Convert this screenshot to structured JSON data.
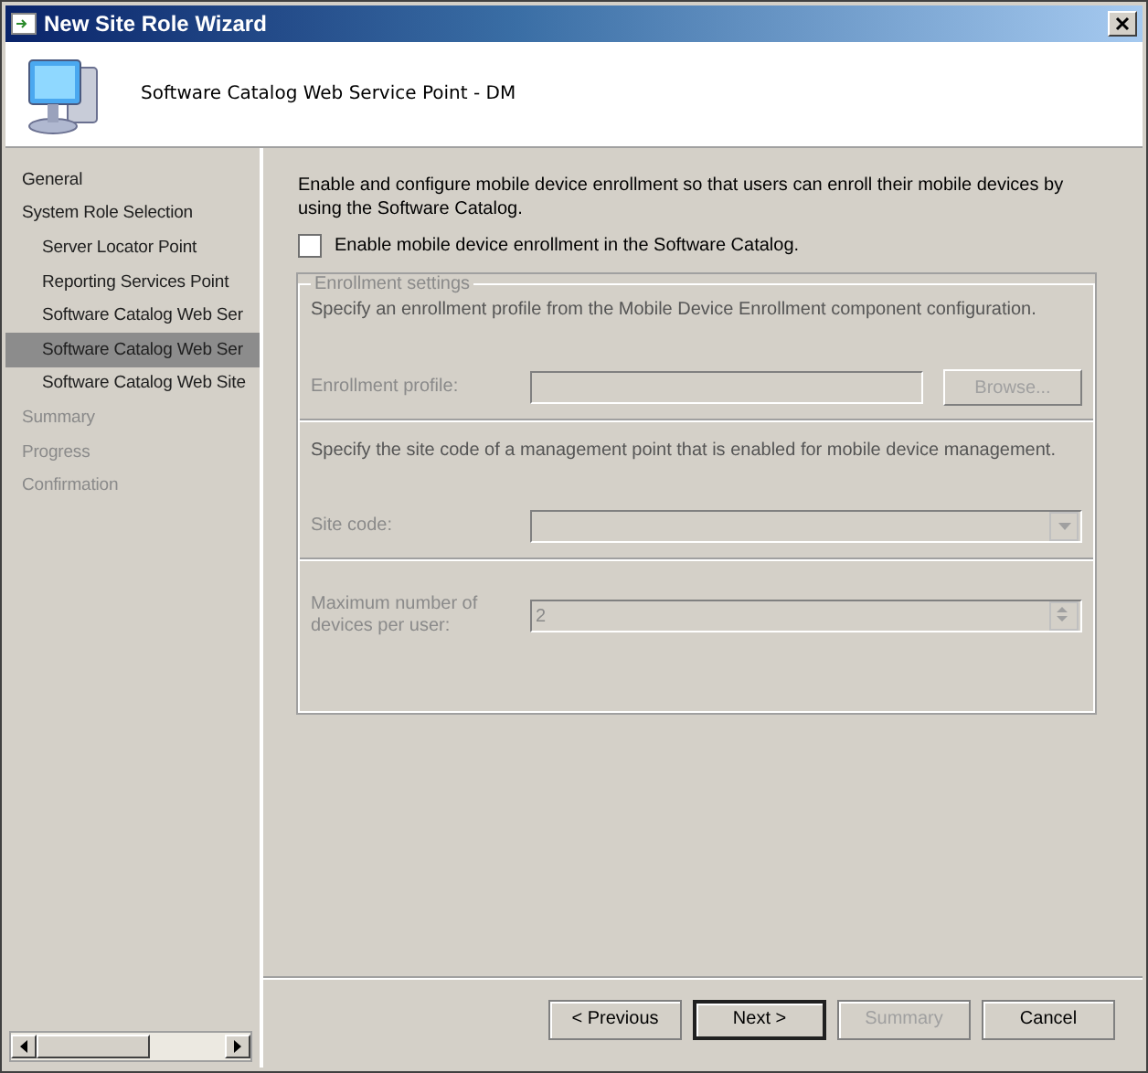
{
  "window": {
    "title": "New Site Role Wizard"
  },
  "header": {
    "title": "Software Catalog Web Service Point - DM"
  },
  "sidebar": {
    "items": [
      {
        "label": "General",
        "selected": false,
        "disabled": false
      },
      {
        "label": "System Role Selection",
        "selected": false,
        "disabled": false,
        "children": [
          {
            "label": "Server Locator Point",
            "selected": false,
            "disabled": false
          },
          {
            "label": "Reporting Services Point",
            "selected": false,
            "disabled": false
          },
          {
            "label": "Software Catalog Web Ser",
            "selected": false,
            "disabled": false
          },
          {
            "label": "Software Catalog Web Ser",
            "selected": true,
            "disabled": false
          },
          {
            "label": "Software Catalog Web Site",
            "selected": false,
            "disabled": false
          }
        ]
      },
      {
        "label": "Summary",
        "selected": false,
        "disabled": true
      },
      {
        "label": "Progress",
        "selected": false,
        "disabled": true
      },
      {
        "label": "Confirmation",
        "selected": false,
        "disabled": true
      }
    ]
  },
  "intro": "Enable and configure mobile device enrollment so that users can enroll their mobile devices by using the Software Catalog.",
  "enable_checkbox": {
    "label": "Enable mobile device enrollment in the Software Catalog.",
    "checked": false
  },
  "group": {
    "title": "Enrollment settings",
    "profile_hint": "Specify an enrollment profile from the Mobile Device Enrollment component configuration.",
    "profile_label": "Enrollment profile:",
    "browse_button": "Browse...",
    "site_hint": "Specify the site code of a management point that is enabled for mobile device management.",
    "site_label": "Site code:",
    "max_label": "Maximum number of devices per user:",
    "max_value": "2"
  },
  "buttons": [
    {
      "label": "< Previous",
      "disabled": false,
      "default": false
    },
    {
      "label": "Next >",
      "disabled": false,
      "default": true
    },
    {
      "label": "Summary",
      "disabled": true,
      "default": false
    },
    {
      "label": "Cancel",
      "disabled": false,
      "default": false
    }
  ]
}
